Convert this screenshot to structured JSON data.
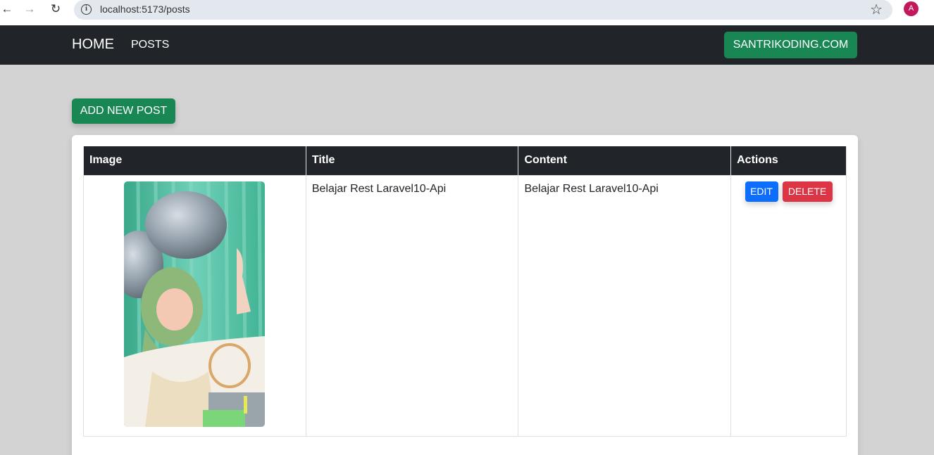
{
  "browser": {
    "url": "localhost:5173/posts",
    "profile_initial": "A",
    "profile_color": "#c2185b"
  },
  "navbar": {
    "brand": "HOME",
    "links": [
      "POSTS"
    ],
    "site_button": "SANTRIKODING.COM"
  },
  "add_button": "ADD NEW POST",
  "table": {
    "headers": [
      "Image",
      "Title",
      "Content",
      "Actions"
    ],
    "rows": [
      {
        "image_alt": "photo of person with balloons",
        "title": "Belajar Rest Laravel10-Api",
        "content": "Belajar Rest Laravel10-Api",
        "edit_label": "EDIT",
        "delete_label": "DELETE"
      }
    ]
  },
  "colors": {
    "navbar_bg": "#212529",
    "success": "#198754",
    "primary": "#0d6efd",
    "danger": "#dc3545",
    "page_bg": "#d3d3d3"
  }
}
